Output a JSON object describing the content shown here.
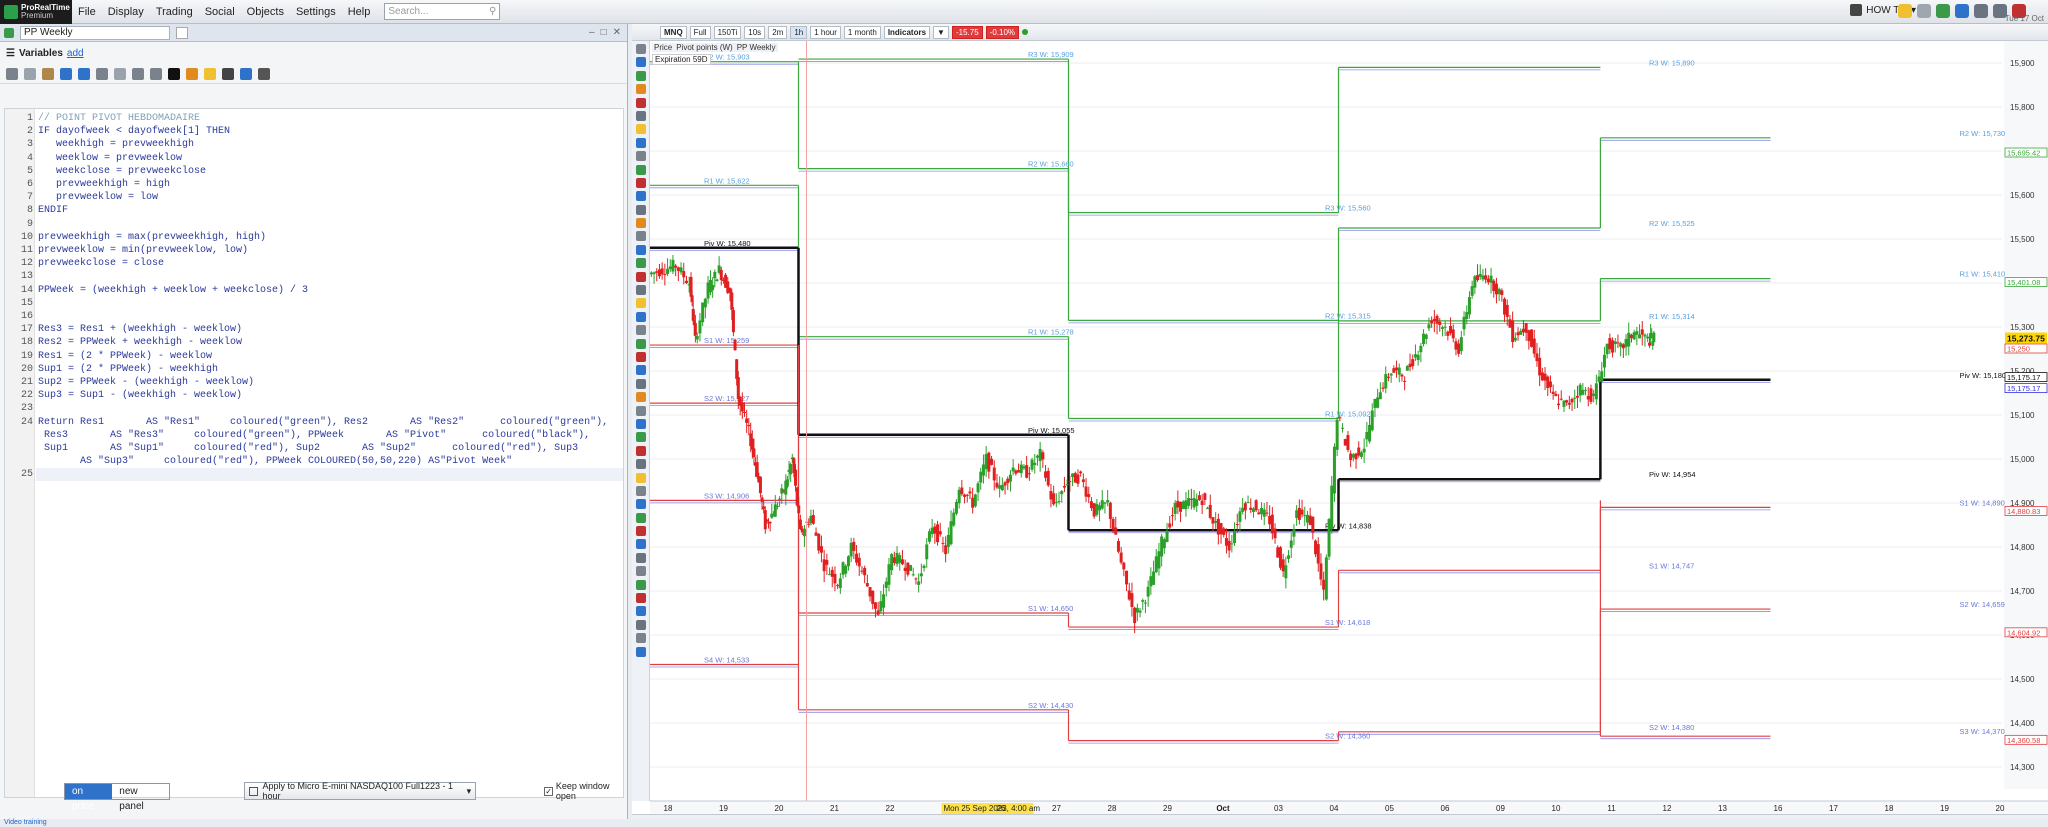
{
  "app": {
    "logo_line1": "ProRealTime",
    "logo_line2": "Premium",
    "menus": [
      "File",
      "Display",
      "Trading",
      "Social",
      "Objects",
      "Settings",
      "Help"
    ],
    "search_placeholder": "Search...",
    "howto_label": "HOW TO",
    "date_text": "Tue 17 Oct",
    "status_text": "Video training"
  },
  "editor": {
    "window_title": "PP Weekly",
    "variables_label": "Variables",
    "variables_add": "add",
    "lines": [
      {
        "n": "1",
        "t": "// POINT PIVOT HEBDOMADAIRE",
        "c": "#7fa3b5"
      },
      {
        "n": "2",
        "t": "IF dayofweek < dayofweek[1] THEN",
        "c": "#2b3a9b"
      },
      {
        "n": "3",
        "t": "   weekhigh = prevweekhigh",
        "c": "#2b3a9b"
      },
      {
        "n": "4",
        "t": "   weeklow = prevweeklow",
        "c": "#2b3a9b"
      },
      {
        "n": "5",
        "t": "   weekclose = prevweekclose",
        "c": "#2b3a9b"
      },
      {
        "n": "6",
        "t": "   prevweekhigh = high",
        "c": "#2b3a9b"
      },
      {
        "n": "7",
        "t": "   prevweeklow = low",
        "c": "#2b3a9b"
      },
      {
        "n": "8",
        "t": "ENDIF",
        "c": "#2b3a9b"
      },
      {
        "n": "9",
        "t": "",
        "c": "#2b3a9b"
      },
      {
        "n": "10",
        "t": "prevweekhigh = max(prevweekhigh, high)",
        "c": "#2b3a9b"
      },
      {
        "n": "11",
        "t": "prevweeklow = min(prevweeklow, low)",
        "c": "#2b3a9b"
      },
      {
        "n": "12",
        "t": "prevweekclose = close",
        "c": "#2b3a9b"
      },
      {
        "n": "13",
        "t": "",
        "c": "#2b3a9b"
      },
      {
        "n": "14",
        "t": "PPWeek = (weekhigh + weeklow + weekclose) / 3",
        "c": "#2b3a9b"
      },
      {
        "n": "15",
        "t": "",
        "c": "#2b3a9b"
      },
      {
        "n": "16",
        "t": "",
        "c": "#2b3a9b"
      },
      {
        "n": "17",
        "t": "Res3 = Res1 + (weekhigh - weeklow)",
        "c": "#2b3a9b"
      },
      {
        "n": "18",
        "t": "Res2 = PPWeek + weekhigh - weeklow",
        "c": "#2b3a9b"
      },
      {
        "n": "19",
        "t": "Res1 = (2 * PPWeek) - weeklow",
        "c": "#2b3a9b"
      },
      {
        "n": "20",
        "t": "Sup1 = (2 * PPWeek) - weekhigh",
        "c": "#2b3a9b"
      },
      {
        "n": "21",
        "t": "Sup2 = PPWeek - (weekhigh - weeklow)",
        "c": "#2b3a9b"
      },
      {
        "n": "22",
        "t": "Sup3 = Sup1 - (weekhigh - weeklow)",
        "c": "#2b3a9b"
      },
      {
        "n": "23",
        "t": "",
        "c": "#2b3a9b"
      },
      {
        "n": "24",
        "t": "Return Res1       AS \"Res1\"     coloured(\"green\"), Res2       AS \"Res2\"      coloured(\"green\"),",
        "c": "#2b3a9b"
      },
      {
        "n": "",
        "t": " Res3       AS \"Res3\"     coloured(\"green\"), PPWeek       AS \"Pivot\"      coloured(\"black\"),",
        "c": "#2b3a9b"
      },
      {
        "n": "",
        "t": " Sup1       AS \"Sup1\"     coloured(\"red\"), Sup2       AS \"Sup2\"      coloured(\"red\"), Sup3",
        "c": "#2b3a9b"
      },
      {
        "n": "",
        "t": "       AS \"Sup3\"     coloured(\"red\"), PPWeek COLOURED(50,50,220) AS\"Pivot Week\"",
        "c": "#2b3a9b"
      },
      {
        "n": "25",
        "t": "",
        "c": "#2b3a9b"
      }
    ],
    "seg_on_price": "on price",
    "seg_new_panel": "new panel",
    "apply_label": "Apply to Micro E-mini NASDAQ100 Full1223 - 1 hour",
    "keep_window_open": "Keep window open"
  },
  "chart_toolbar": {
    "symbol": "MNQ",
    "mode": "Full",
    "timeframes": [
      "150Ti",
      "10s",
      "2m",
      "1h"
    ],
    "interval": "1 hour",
    "period": "1 month",
    "indicators": "Indicators",
    "change_pts": "-15.75",
    "change_pct": "-0.10%"
  },
  "legend": {
    "price": "Price",
    "price_tag": "",
    "pivot": "Pivot points (W)",
    "ppw": "PP Weekly",
    "expiration": "Expiration",
    "expiration_days": "59D"
  },
  "colors": {
    "up": "#2aa02a",
    "down": "#e02020",
    "res": "#3aa83a",
    "sup": "#e04040",
    "pivot": "#111111",
    "pivot_week": "#3232dc",
    "res_label": "#5aa0e0",
    "sup_label": "#6a78d8",
    "current_price": "#ffd600"
  },
  "chart_data": {
    "type": "line",
    "title": "",
    "y_axis_ticks": [
      "15,900",
      "15,800",
      "15,700",
      "15,600",
      "15,500",
      "15,400",
      "15,300",
      "15,200",
      "15,100",
      "15,000",
      "14,900",
      "14,800",
      "14,700",
      "14,600",
      "14,500",
      "14,400",
      "14,300"
    ],
    "ylim": [
      14250,
      15950
    ],
    "x_axis_ticks": [
      "18",
      "19",
      "20",
      "21",
      "22",
      "Mon 25 Sep 2023, 4:00 am",
      "26",
      "27",
      "28",
      "29",
      "Oct",
      "03",
      "04",
      "05",
      "06",
      "09",
      "10",
      "11",
      "12",
      "13",
      "16",
      "17",
      "18",
      "19",
      "20"
    ],
    "current_price_label": "15,273.75",
    "right_labels": [
      {
        "text": "15,695.42",
        "y": 15695.42,
        "color": "#3aa83a"
      },
      {
        "text": "15,401.08",
        "y": 15401.08,
        "color": "#3aa83a"
      },
      {
        "text": "15,250",
        "y": 15250,
        "color": "#e04040"
      },
      {
        "text": "15,175.17",
        "y": 15185,
        "color": "#111111"
      },
      {
        "text": "15,175.17",
        "y": 15160,
        "color": "#3232dc"
      },
      {
        "text": "14,880.83",
        "y": 14880.83,
        "color": "#e04040"
      },
      {
        "text": "14,604.92",
        "y": 14604.92,
        "color": "#e04040"
      },
      {
        "text": "14,360.58",
        "y": 14360.58,
        "color": "#e04040"
      }
    ],
    "level_labels": [
      {
        "text": "R2 W: 15,903",
        "y": 15903,
        "x": 0.2
      },
      {
        "text": "R1 W: 15,622",
        "y": 15622,
        "x": 0.2
      },
      {
        "text": "Piv W: 15,480",
        "y": 15480,
        "x": 0.2
      },
      {
        "text": "S1 W: 15,259",
        "y": 15259,
        "x": 0.2
      },
      {
        "text": "S2 W: 15,127",
        "y": 15127,
        "x": 0.2
      },
      {
        "text": "S3 W: 14,906",
        "y": 14906,
        "x": 0.2
      },
      {
        "text": "S4 W: 14,533",
        "y": 14533,
        "x": 0.2
      },
      {
        "text": "R3 W: 15,909",
        "y": 15909,
        "x": 1.4
      },
      {
        "text": "R2 W: 15,660",
        "y": 15660,
        "x": 1.4
      },
      {
        "text": "R1 W: 15,278",
        "y": 15278,
        "x": 1.4
      },
      {
        "text": "Piv W: 15,055",
        "y": 15055,
        "x": 1.4
      },
      {
        "text": "S1 W: 14,650",
        "y": 14650,
        "x": 1.4
      },
      {
        "text": "S2 W: 14,430",
        "y": 14430,
        "x": 1.4
      },
      {
        "text": "R3 W: 15,560",
        "y": 15560,
        "x": 2.5
      },
      {
        "text": "R2 W: 15,315",
        "y": 15315,
        "x": 2.5
      },
      {
        "text": "R1 W: 15,092",
        "y": 15092,
        "x": 2.5
      },
      {
        "text": "Piv W: 14,838",
        "y": 14838,
        "x": 2.5
      },
      {
        "text": "S1 W: 14,618",
        "y": 14618,
        "x": 2.5
      },
      {
        "text": "S2 W: 14,360",
        "y": 14360,
        "x": 2.5
      },
      {
        "text": "R3 W: 15,890",
        "y": 15890,
        "x": 3.7
      },
      {
        "text": "R2 W: 15,525",
        "y": 15525,
        "x": 3.7
      },
      {
        "text": "R1 W: 15,314",
        "y": 15314,
        "x": 3.7
      },
      {
        "text": "Piv W: 14,954",
        "y": 14954,
        "x": 3.7
      },
      {
        "text": "S1 W: 14,747",
        "y": 14747,
        "x": 3.7
      },
      {
        "text": "S2 W: 14,380",
        "y": 14380,
        "x": 3.7
      },
      {
        "text": "R2 W: 15,730",
        "y": 15730,
        "x": 4.85
      },
      {
        "text": "R1 W: 15,410",
        "y": 15410,
        "x": 4.85
      },
      {
        "text": "Piv W: 15,180",
        "y": 15180,
        "x": 4.85
      },
      {
        "text": "S1 W: 14,890",
        "y": 14890,
        "x": 4.85
      },
      {
        "text": "S2 W: 14,659",
        "y": 14659,
        "x": 4.85
      },
      {
        "text": "S3 W: 14,370",
        "y": 14370,
        "x": 4.85
      }
    ],
    "weeks": [
      {
        "x0": 0,
        "x1": 0.55,
        "r2": 15903,
        "r1": 15622,
        "piv": 15480,
        "s1": 15259,
        "s2": 15127,
        "s3": 14906,
        "s4": 14533
      },
      {
        "x0": 0.55,
        "x1": 1.55,
        "r3": 15909,
        "r2": 15660,
        "r1": 15278,
        "piv": 15055,
        "s1": 14650,
        "s2": 14430
      },
      {
        "x0": 1.55,
        "x1": 2.55,
        "r3": 15560,
        "r2": 15315,
        "r1": 15092,
        "piv": 14838,
        "s1": 14618,
        "s2": 14360
      },
      {
        "x0": 2.55,
        "x1": 3.52,
        "r3": 15890,
        "r2": 15525,
        "r1": 15314,
        "piv": 14954,
        "s1": 14747,
        "s2": 14380
      },
      {
        "x0": 3.52,
        "x1": 4.15,
        "r2": 15730,
        "r1": 15410,
        "piv": 15180,
        "s1": 14890,
        "s2": 14659,
        "s3": 14370
      }
    ],
    "price_path": [
      [
        0.0,
        15420
      ],
      [
        0.05,
        15430
      ],
      [
        0.1,
        15440
      ],
      [
        0.15,
        15400
      ],
      [
        0.17,
        15270
      ],
      [
        0.22,
        15390
      ],
      [
        0.26,
        15430
      ],
      [
        0.3,
        15380
      ],
      [
        0.33,
        15140
      ],
      [
        0.37,
        15060
      ],
      [
        0.4,
        14970
      ],
      [
        0.43,
        14850
      ],
      [
        0.46,
        14880
      ],
      [
        0.5,
        14930
      ],
      [
        0.53,
        15000
      ],
      [
        0.56,
        14830
      ],
      [
        0.6,
        14870
      ],
      [
        0.65,
        14760
      ],
      [
        0.7,
        14720
      ],
      [
        0.75,
        14800
      ],
      [
        0.8,
        14730
      ],
      [
        0.85,
        14640
      ],
      [
        0.9,
        14780
      ],
      [
        0.95,
        14760
      ],
      [
        1.0,
        14720
      ],
      [
        1.05,
        14850
      ],
      [
        1.1,
        14790
      ],
      [
        1.15,
        14940
      ],
      [
        1.2,
        14900
      ],
      [
        1.25,
        15000
      ],
      [
        1.3,
        14930
      ],
      [
        1.35,
        14980
      ],
      [
        1.4,
        14970
      ],
      [
        1.45,
        15010
      ],
      [
        1.5,
        14890
      ],
      [
        1.55,
        14950
      ],
      [
        1.6,
        14960
      ],
      [
        1.65,
        14880
      ],
      [
        1.7,
        14900
      ],
      [
        1.75,
        14760
      ],
      [
        1.8,
        14640
      ],
      [
        1.85,
        14700
      ],
      [
        1.9,
        14810
      ],
      [
        1.95,
        14890
      ],
      [
        2.0,
        14900
      ],
      [
        2.05,
        14910
      ],
      [
        2.1,
        14850
      ],
      [
        2.15,
        14800
      ],
      [
        2.2,
        14900
      ],
      [
        2.25,
        14890
      ],
      [
        2.3,
        14860
      ],
      [
        2.35,
        14740
      ],
      [
        2.4,
        14880
      ],
      [
        2.45,
        14860
      ],
      [
        2.5,
        14690
      ],
      [
        2.55,
        15100
      ],
      [
        2.6,
        15000
      ],
      [
        2.65,
        15030
      ],
      [
        2.7,
        15150
      ],
      [
        2.75,
        15200
      ],
      [
        2.8,
        15190
      ],
      [
        2.85,
        15250
      ],
      [
        2.9,
        15320
      ],
      [
        2.95,
        15300
      ],
      [
        3.0,
        15250
      ],
      [
        3.05,
        15400
      ],
      [
        3.1,
        15420
      ],
      [
        3.15,
        15380
      ],
      [
        3.2,
        15280
      ],
      [
        3.25,
        15300
      ],
      [
        3.3,
        15200
      ],
      [
        3.35,
        15140
      ],
      [
        3.4,
        15120
      ],
      [
        3.45,
        15160
      ],
      [
        3.5,
        15140
      ],
      [
        3.55,
        15260
      ],
      [
        3.6,
        15250
      ],
      [
        3.65,
        15290
      ],
      [
        3.7,
        15270
      ],
      [
        3.72,
        15274
      ]
    ],
    "cursor_x_label_index": 5
  }
}
